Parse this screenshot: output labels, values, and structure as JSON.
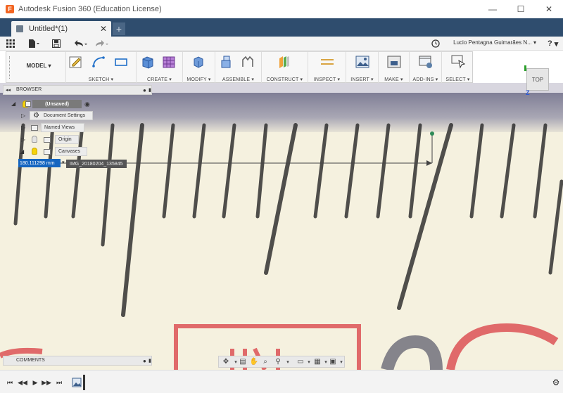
{
  "window": {
    "title": "Autodesk Fusion 360 (Education License)",
    "logo_letter": "F"
  },
  "tabs": [
    {
      "label": "Untitled*(1)"
    }
  ],
  "qat": {
    "user_name": "Lucio Pentagna Guimarães N... ▾",
    "help": "?"
  },
  "ribbon": {
    "workspace": "MODEL ▾",
    "groups": [
      {
        "label": "SKETCH ▾"
      },
      {
        "label": "CREATE ▾"
      },
      {
        "label": "MODIFY ▾"
      },
      {
        "label": "ASSEMBLE ▾"
      },
      {
        "label": "CONSTRUCT ▾"
      },
      {
        "label": "INSPECT ▾"
      },
      {
        "label": "INSERT ▾"
      },
      {
        "label": "MAKE ▾"
      },
      {
        "label": "ADD-INS ▾"
      },
      {
        "label": "SELECT ▾"
      }
    ]
  },
  "browser": {
    "title": "BROWSER",
    "root": "(Unsaved)",
    "items": [
      {
        "label": "Document Settings"
      },
      {
        "label": "Named Views"
      },
      {
        "label": "Origin"
      },
      {
        "label": "Canvases"
      }
    ]
  },
  "dimension": {
    "value": "180.111298 mm",
    "canvas_name": "IMG_20180204_135845"
  },
  "viewcube": {
    "face": "TOP",
    "axis": "Z"
  },
  "comments": {
    "title": "COMMENTS"
  },
  "colors": {
    "tabbar": "#2f4d6e",
    "accent": "#1565c0",
    "ruler_red": "#e06a6a"
  }
}
